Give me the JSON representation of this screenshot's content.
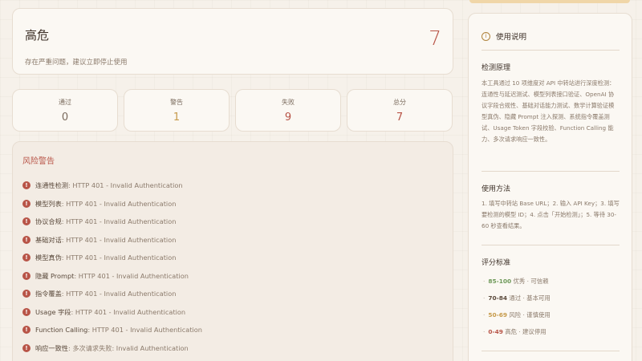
{
  "verdict": {
    "title": "高危",
    "subtitle": "存在严重问题，建议立即停止使用",
    "score": "7"
  },
  "stats": [
    {
      "label": "通过",
      "value": "0",
      "color": "#7a6a5c"
    },
    {
      "label": "警告",
      "value": "1",
      "color": "#c69a4a"
    },
    {
      "label": "失败",
      "value": "9",
      "color": "#b85447"
    },
    {
      "label": "总分",
      "value": "7",
      "color": "#b85447"
    }
  ],
  "warnings": {
    "title": "风险警告",
    "items": [
      {
        "name": "连通性检测",
        "detail": ": HTTP 401 - Invalid Authentication"
      },
      {
        "name": "模型列表",
        "detail": ": HTTP 401 - Invalid Authentication"
      },
      {
        "name": "协议合规",
        "detail": ": HTTP 401 - Invalid Authentication"
      },
      {
        "name": "基础对话",
        "detail": ": HTTP 401 - Invalid Authentication"
      },
      {
        "name": "模型真伪",
        "detail": ": HTTP 401 - Invalid Authentication"
      },
      {
        "name": "隐藏 Prompt",
        "detail": ": HTTP 401 - Invalid Authentication"
      },
      {
        "name": "指令覆盖",
        "detail": ": HTTP 401 - Invalid Authentication"
      },
      {
        "name": "Usage 字段",
        "detail": ": HTTP 401 - Invalid Authentication"
      },
      {
        "name": "Function Calling",
        "detail": ": HTTP 401 - Invalid Authentication"
      },
      {
        "name": "响应一致性",
        "detail": ": 多次请求失败: Invalid Authentication"
      }
    ]
  },
  "sidebar": {
    "title": "使用说明",
    "principle_title": "检测原理",
    "principle_text": "本工具通过 10 项维度对 API 中转站进行深度检测：连通性与延迟测试、模型列表接口验证、OpenAI 协议字段合规性、基础对话能力测试、数学计算验证模型真伪、隐藏 Prompt 注入探测、系统指令覆盖测试、Usage Token 字段校验、Function Calling 能力、多次请求响应一致性。",
    "usage_title": "使用方法",
    "usage_text": "1. 填写中转站 Base URL；2. 输入 API Key；3. 填写要检测的模型 ID；4. 点击「开始检测」；5. 等待 30-60 秒查看结果。",
    "scoring_title": "评分标准",
    "scoring": [
      {
        "range": "85-100",
        "text": " 优秀 · 可信赖",
        "color": "#6f9a5a"
      },
      {
        "range": "70-84",
        "text": " 通过 · 基本可用",
        "color": "#5b4a3c"
      },
      {
        "range": "50-69",
        "text": " 风险 · 谨慎使用",
        "color": "#c69a4a"
      },
      {
        "range": "0-49",
        "text": " 高危 · 建议停用",
        "color": "#b85447"
      }
    ]
  }
}
